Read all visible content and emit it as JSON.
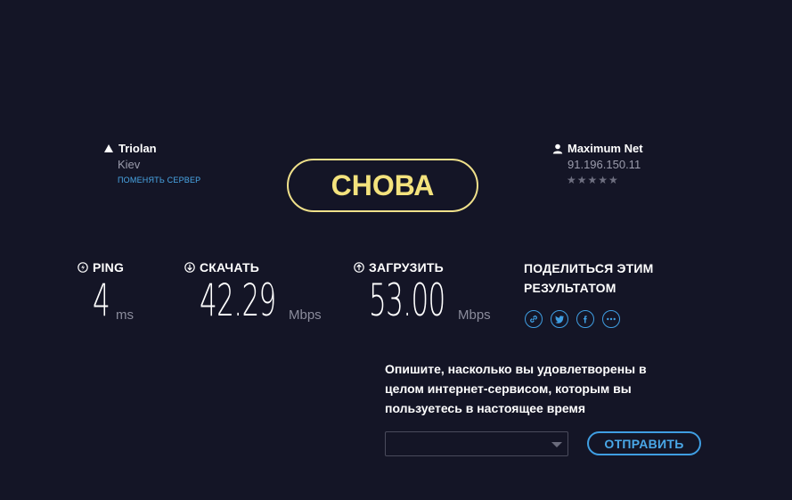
{
  "isp": {
    "name": "Triolan",
    "location": "Kiev",
    "change_server": "ПОМЕНЯТЬ СЕРВЕР"
  },
  "host": {
    "name": "Maximum Net",
    "ip": "91.196.150.11",
    "stars": "★★★★★"
  },
  "again_button": "СНОВА",
  "ping": {
    "label": "PING",
    "value": "4",
    "unit": "ms"
  },
  "download": {
    "label": "СКАЧАТЬ",
    "value": "42.29",
    "unit": "Mbps"
  },
  "upload": {
    "label": "ЗАГРУЗИТЬ",
    "value": "53.00",
    "unit": "Mbps"
  },
  "share": {
    "title_line1": "ПОДЕЛИТЬСЯ ЭТИМ",
    "title_line2": "РЕЗУЛЬТАТОМ",
    "icons": [
      "link-icon",
      "twitter-icon",
      "facebook-icon",
      "more-icon"
    ]
  },
  "survey": {
    "line1": "Опишите, насколько вы удовлетворены в",
    "line2": "целом интернет-сервисом, которым вы",
    "line3": "пользуетесь в настоящее время",
    "select_value": "",
    "submit": "ОТПРАВИТЬ"
  },
  "colors": {
    "background": "#141526",
    "accent_yellow": "#f3e27d",
    "accent_blue": "#3f9ee2"
  }
}
